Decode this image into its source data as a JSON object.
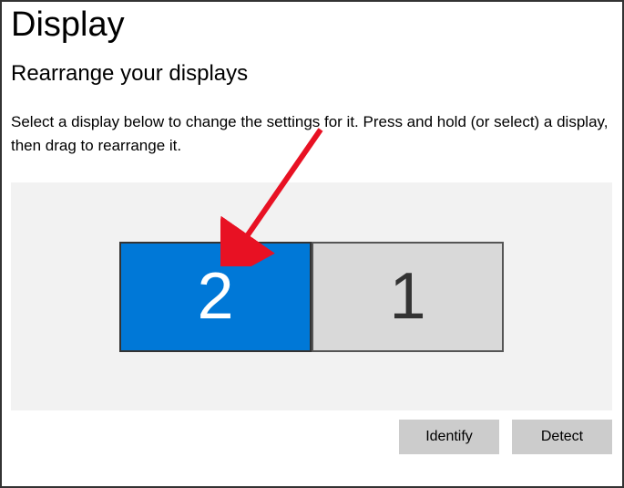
{
  "page": {
    "title": "Display",
    "section_title": "Rearrange your displays",
    "description": "Select a display below to change the settings for it. Press and hold (or select) a display, then drag to rearrange it."
  },
  "displays": [
    {
      "label": "2",
      "selected": true
    },
    {
      "label": "1",
      "selected": false
    }
  ],
  "buttons": {
    "identify": "Identify",
    "detect": "Detect"
  },
  "annotation": {
    "arrow_color": "#e81123"
  }
}
